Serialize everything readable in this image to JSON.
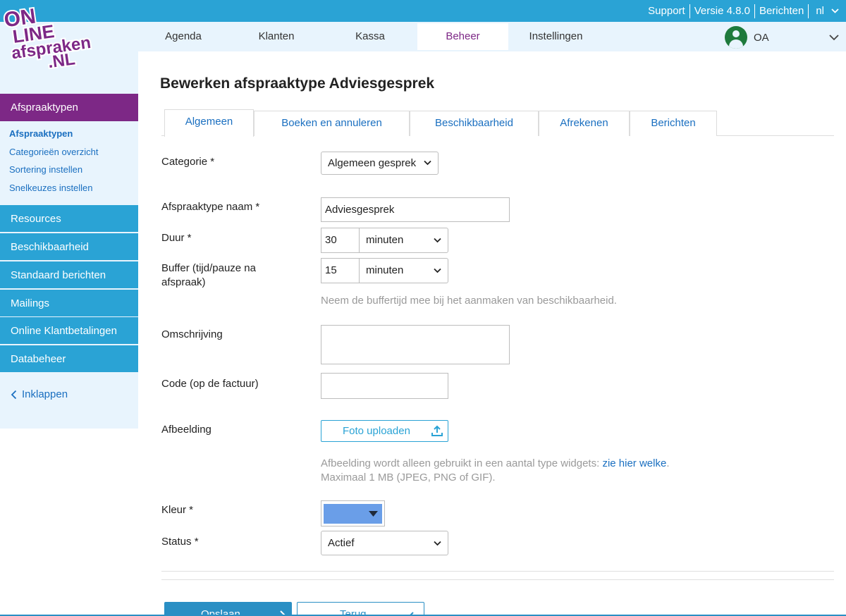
{
  "topbar": {
    "support": "Support",
    "version": "Versie 4.8.0",
    "messages": "Berichten",
    "language": "nl"
  },
  "logo": {
    "line1": "ON",
    "line2": "LINE",
    "line3": "afspraken",
    "line4": ".NL"
  },
  "nav": {
    "items": [
      "Agenda",
      "Klanten",
      "Kassa",
      "Beheer",
      "Instellingen"
    ],
    "active": "Beheer",
    "user_initials": "OA"
  },
  "sidebar": {
    "header": "Afspraaktypen",
    "sub_items": [
      "Afspraaktypen",
      "Categorieën overzicht",
      "Sortering instellen",
      "Snelkeuzes instellen"
    ],
    "sections": [
      "Resources",
      "Beschikbaarheid",
      "Standaard berichten",
      "Mailings",
      "Online Klantbetalingen",
      "Databeheer"
    ],
    "collapse": "Inklappen"
  },
  "page": {
    "title": "Bewerken afspraaktype Adviesgesprek"
  },
  "tabs": [
    "Algemeen",
    "Boeken en annuleren",
    "Beschikbaarheid",
    "Afrekenen",
    "Berichten"
  ],
  "form": {
    "category_label": "Categorie *",
    "category_value": "Algemeen gesprek",
    "name_label": "Afspraaktype naam *",
    "name_value": "Adviesgesprek",
    "duration_label": "Duur *",
    "duration_value": "30",
    "duration_unit": "minuten",
    "buffer_label": "Buffer (tijd/pauze na afspraak)",
    "buffer_value": "15",
    "buffer_unit": "minuten",
    "buffer_hint": "Neem de buffertijd mee bij het aanmaken van beschikbaarheid.",
    "description_label": "Omschrijving",
    "description_value": "",
    "code_label": "Code (op de factuur)",
    "code_value": "",
    "image_label": "Afbeelding",
    "upload_button": "Foto uploaden",
    "image_hint_prefix": "Afbeelding wordt alleen gebruikt in een aantal type widgets: ",
    "image_hint_link": "zie hier welke",
    "image_hint_suffix": ".",
    "image_hint_line2": "Maximaal 1 MB (JPEG, PNG of GIF).",
    "color_label": "Kleur *",
    "color_value": "#6a9ee8",
    "status_label": "Status *",
    "status_value": "Actief"
  },
  "actions": {
    "save": "Opslaan",
    "back": "Terug"
  },
  "colors": {
    "primary_blue": "#2aa3d5",
    "brand_purple": "#7d2886",
    "link_blue": "#1a6fc0",
    "light_bg": "#e8f4fd"
  }
}
